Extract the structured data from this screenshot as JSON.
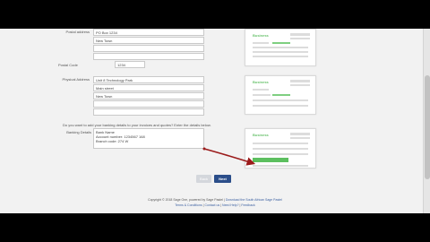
{
  "form": {
    "postal_address_label": "Postal address",
    "postal_lines": [
      "PO Box 1234",
      "New Town",
      "",
      ""
    ],
    "postal_code_label": "Postal Code",
    "postal_code": "1234",
    "physical_address_label": "Physical Address",
    "physical_lines": [
      "Unit 8 Technology Park",
      "Main street",
      "New Town",
      "",
      ""
    ],
    "banking_prompt": "Do you want to add your banking details to your invoices and quotes? Enter the details below.",
    "banking_label": "Banking Details",
    "banking_text": "Bank Name\nAccount number: 1234567 168\nBranch code: 274 W"
  },
  "thumbnails": {
    "brand": "Business"
  },
  "buttons": {
    "back": "Back",
    "next": "Next"
  },
  "footer": {
    "copyright": "Copyright © 2018 Sage One, powered by Sage Pastel",
    "sep1": " | ",
    "link_download": "Download the South African Sage Pastel",
    "links": [
      "Terms & Conditions",
      "Contact us",
      "Need Help?",
      "Feedback"
    ],
    "link_sep": " | "
  },
  "colors": {
    "accent_green": "#5cbf5f",
    "next_button": "#2b4e8a",
    "arrow": "#9b1b1b"
  }
}
